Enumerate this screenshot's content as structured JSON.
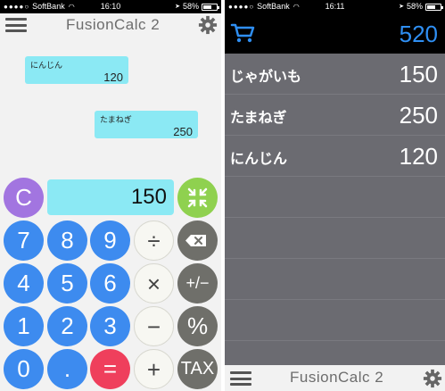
{
  "left": {
    "status": {
      "carrier": "SoftBank",
      "time": "16:10",
      "battery": "58%",
      "battery_level": 0.58
    },
    "header": {
      "title": "FusionCalc 2",
      "menu_icon": "hamburger-menu-icon",
      "settings_icon": "gear-icon"
    },
    "tape": [
      {
        "name": "にんじん",
        "amount": "120"
      },
      {
        "name": "たまねぎ",
        "amount": "250"
      }
    ],
    "display": {
      "clear_label": "C",
      "value": "150",
      "shrink_icon": "shrink-arrows-icon"
    },
    "keys": {
      "k7": "7",
      "k8": "8",
      "k9": "9",
      "divide": "÷",
      "backspace_icon": "backspace-icon",
      "k4": "4",
      "k5": "5",
      "k6": "6",
      "multiply": "×",
      "sign": "+/−",
      "k1": "1",
      "k2": "2",
      "k3": "3",
      "minus": "−",
      "percent": "%",
      "k0": "0",
      "dot": ".",
      "equals": "=",
      "plus": "+",
      "tax": "TAX"
    },
    "colors": {
      "number_key": "#3d8bef",
      "equals_key": "#ef3f5c",
      "clear_key": "#a275e0",
      "shrink_key": "#8fd14f",
      "display_bg": "#8be9f4",
      "function_key": "#6f6f6a"
    }
  },
  "right": {
    "status": {
      "carrier": "SoftBank",
      "time": "16:11",
      "battery": "58%",
      "battery_level": 0.58
    },
    "header": {
      "cart_icon": "shopping-cart-icon",
      "total": "520"
    },
    "items": [
      {
        "name": "じゃがいも",
        "value": "150"
      },
      {
        "name": "たまねぎ",
        "value": "250"
      },
      {
        "name": "にんじん",
        "value": "120"
      }
    ],
    "footer": {
      "title": "FusionCalc 2",
      "menu_icon": "hamburger-menu-icon",
      "settings_icon": "gear-icon"
    }
  }
}
